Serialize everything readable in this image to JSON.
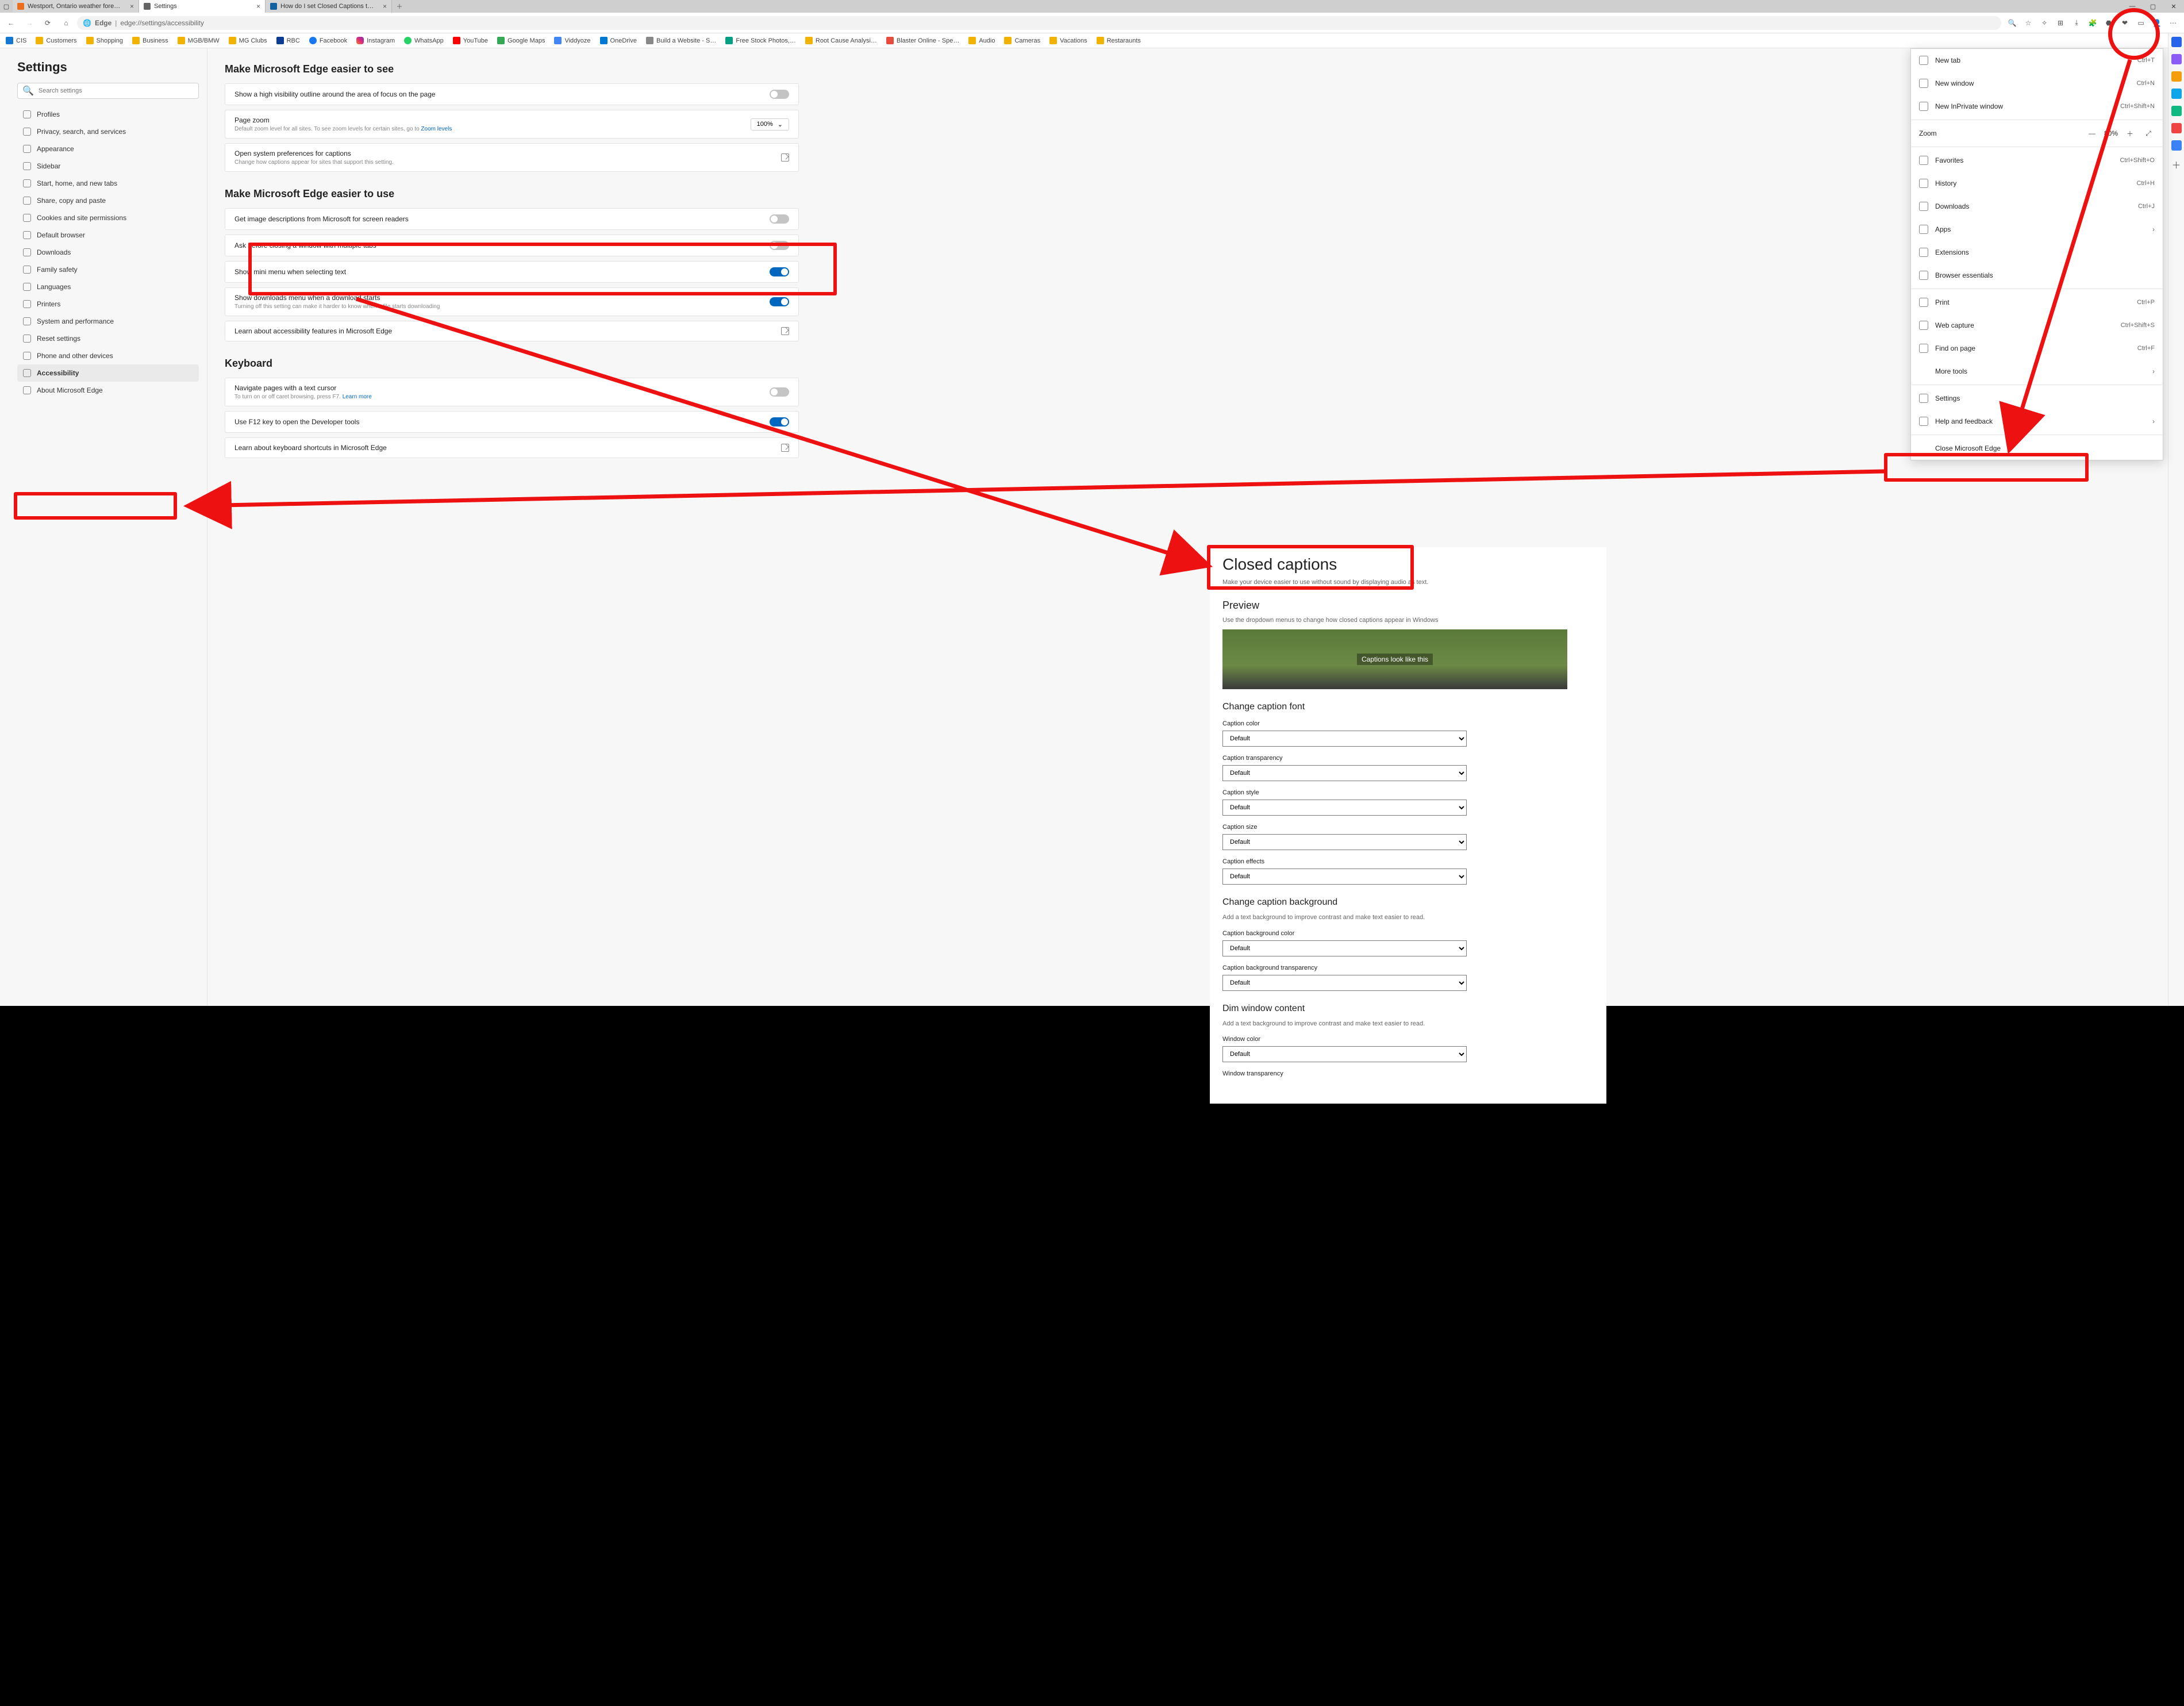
{
  "tabs": {
    "t1": "Westport, Ontario weather fore…",
    "t2": "Settings",
    "t3": "How do I set Closed Captions t…"
  },
  "address": {
    "label": "Edge",
    "url": "edge://settings/accessibility"
  },
  "bookmarks": {
    "b0": "CIS",
    "b1": "Customers",
    "b2": "Shopping",
    "b3": "Business",
    "b4": "MGB/BMW",
    "b5": "MG Clubs",
    "b6": "RBC",
    "b7": "Facebook",
    "b8": "Instagram",
    "b9": "WhatsApp",
    "b10": "YouTube",
    "b11": "Google Maps",
    "b12": "Viddyoze",
    "b13": "OneDrive",
    "b14": "Build a Website - S…",
    "b15": "Free Stock Photos,…",
    "b16": "Root Cause Analysi…",
    "b17": "Blaster Online - Spe…",
    "b18": "Audio",
    "b19": "Cameras",
    "b20": "Vacations",
    "b21": "Restaraunts"
  },
  "settings": {
    "title": "Settings",
    "search_ph": "Search settings",
    "nav": {
      "n0": "Profiles",
      "n1": "Privacy, search, and services",
      "n2": "Appearance",
      "n3": "Sidebar",
      "n4": "Start, home, and new tabs",
      "n5": "Share, copy and paste",
      "n6": "Cookies and site permissions",
      "n7": "Default browser",
      "n8": "Downloads",
      "n9": "Family safety",
      "n10": "Languages",
      "n11": "Printers",
      "n12": "System and performance",
      "n13": "Reset settings",
      "n14": "Phone and other devices",
      "n15": "Accessibility",
      "n16": "About Microsoft Edge"
    },
    "sec1": "Make Microsoft Edge easier to see",
    "r_outline": "Show a high visibility outline around the area of focus on the page",
    "r_zoom": "Page zoom",
    "r_zoom_sub": "Default zoom level for all sites. To see zoom levels for certain sites, go to ",
    "r_zoom_link": "Zoom levels",
    "r_zoom_val": "100%",
    "r_cap": "Open system preferences for captions",
    "r_cap_sub": "Change how captions appear for sites that support this setting.",
    "sec2": "Make Microsoft Edge easier to use",
    "r_img": "Get image descriptions from Microsoft for screen readers",
    "r_ask": "Ask before closing a window with multiple tabs",
    "r_mini": "Show mini menu when selecting text",
    "r_dlm": "Show downloads menu when a download starts",
    "r_dlm_sub": "Turning off this setting can make it harder to know when a file starts downloading",
    "r_learnacc": "Learn about accessibility features in Microsoft Edge",
    "sec3": "Keyboard",
    "r_caret": "Navigate pages with a text cursor",
    "r_caret_sub": "To turn on or off caret browsing, press F7. ",
    "r_caret_link": "Learn more",
    "r_f12": "Use F12 key to open the Developer tools",
    "r_kbd": "Learn about keyboard shortcuts in Microsoft Edge"
  },
  "cc": {
    "title": "Closed captions",
    "desc": "Make your device easier to use without sound by displaying audio as text.",
    "preview_h": "Preview",
    "preview_d": "Use the dropdown menus to change how closed captions appear in Windows",
    "preview_txt": "Captions look like this",
    "font_h": "Change caption font",
    "l_color": "Caption color",
    "l_trans": "Caption transparency",
    "l_style": "Caption style",
    "l_size": "Caption size",
    "l_eff": "Caption effects",
    "bg_h": "Change caption background",
    "bg_d": "Add a text background to improve contrast and make text easier to read.",
    "l_bgc": "Caption background color",
    "l_bgt": "Caption background transparency",
    "dim_h": "Dim window content",
    "dim_d": "Add a text background to improve contrast and make text easier to read.",
    "l_wc": "Window color",
    "l_wt": "Window transparency",
    "opt_default": "Default"
  },
  "menu": {
    "newtab": "New tab",
    "newtab_k": "Ctrl+T",
    "newwin": "New window",
    "newwin_k": "Ctrl+N",
    "inpriv": "New InPrivate window",
    "inpriv_k": "Ctrl+Shift+N",
    "zoom": "Zoom",
    "zoom_v": "80%",
    "fav": "Favorites",
    "fav_k": "Ctrl+Shift+O",
    "hist": "History",
    "hist_k": "Ctrl+H",
    "dl": "Downloads",
    "dl_k": "Ctrl+J",
    "apps": "Apps",
    "ext": "Extensions",
    "be": "Browser essentials",
    "print": "Print",
    "print_k": "Ctrl+P",
    "cap": "Web capture",
    "cap_k": "Ctrl+Shift+S",
    "find": "Find on page",
    "find_k": "Ctrl+F",
    "more": "More tools",
    "set": "Settings",
    "help": "Help and feedback",
    "close": "Close Microsoft Edge"
  }
}
